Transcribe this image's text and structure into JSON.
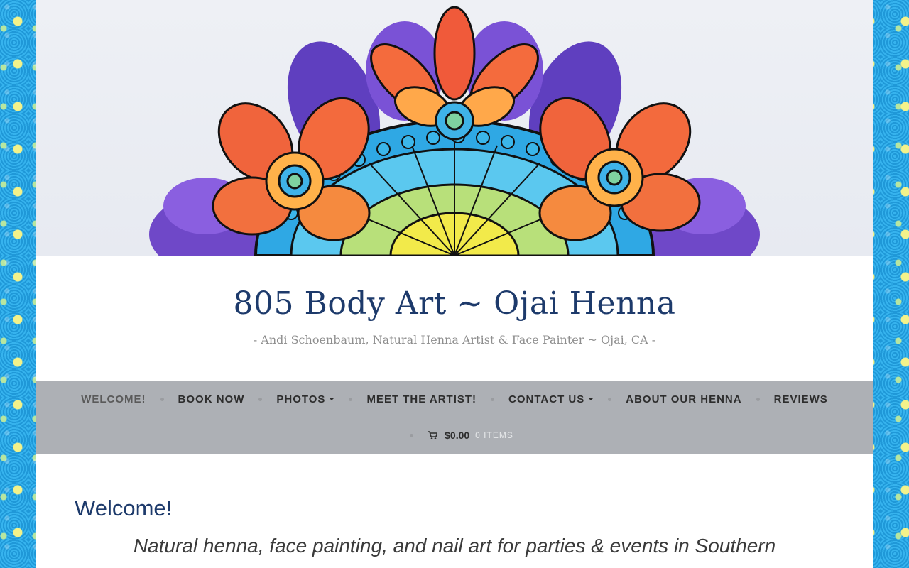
{
  "site": {
    "title": "805 Body Art ~ Ojai Henna",
    "description": "- Andi Schoenbaum, Natural Henna Artist & Face Painter ~ Ojai, CA -"
  },
  "header_image": {
    "icon": "mandala-flower-illustration",
    "colors": [
      "#7b4ccf",
      "#f05a3a",
      "#ffb84a",
      "#3fb3e8",
      "#f1e84a"
    ]
  },
  "nav": {
    "items": [
      {
        "label": "WELCOME!",
        "current": true,
        "dropdown": false
      },
      {
        "label": "BOOK NOW",
        "current": false,
        "dropdown": false
      },
      {
        "label": "PHOTOS",
        "current": false,
        "dropdown": true
      },
      {
        "label": "MEET THE ARTIST!",
        "current": false,
        "dropdown": false
      },
      {
        "label": "CONTACT US",
        "current": false,
        "dropdown": true
      },
      {
        "label": "ABOUT OUR HENNA",
        "current": false,
        "dropdown": false
      },
      {
        "label": "REVIEWS",
        "current": false,
        "dropdown": false
      }
    ],
    "cart": {
      "icon": "cart-icon",
      "total": "$0.00",
      "count": "0 ITEMS"
    }
  },
  "content": {
    "title": "Welcome!",
    "intro": "Natural henna, face painting, and nail art for parties & events in Southern"
  },
  "colors": {
    "title": "#1d3a6b",
    "nav_bg": "#adb0b5",
    "background_pattern": "#29a9e6"
  }
}
